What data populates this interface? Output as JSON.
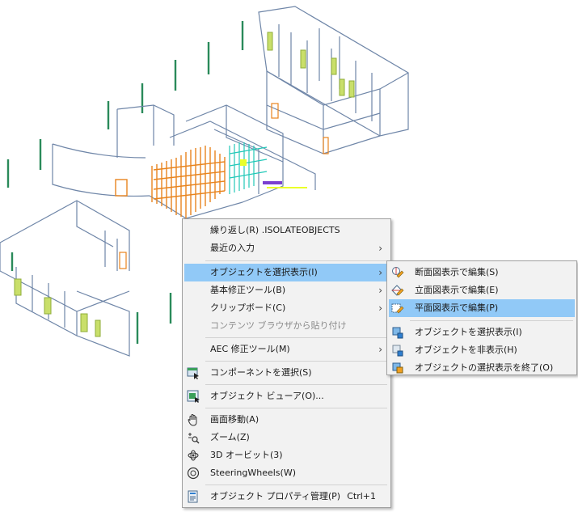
{
  "context_menu": {
    "items": [
      {
        "label": "繰り返し(R) .ISOLATEOBJECTS"
      },
      {
        "label": "最近の入力",
        "arrow": "›"
      },
      {
        "label": "オブジェクトを選択表示(I)",
        "arrow": "›"
      },
      {
        "label": "基本修正ツール(B)",
        "arrow": "›"
      },
      {
        "label": "クリップボード(C)",
        "arrow": "›"
      },
      {
        "label": "コンテンツ ブラウザから貼り付け"
      },
      {
        "label": "AEC 修正ツール(M)",
        "arrow": "›"
      },
      {
        "label": "コンポーネントを選択(S)",
        "icon": "component-select-icon"
      },
      {
        "label": "オブジェクト ビューア(O)...",
        "icon": "object-viewer-icon"
      },
      {
        "label": "画面移動(A)",
        "icon": "hand-pan-icon"
      },
      {
        "label": "ズーム(Z)",
        "icon": "zoom-icon"
      },
      {
        "label": "3D オービット(3)",
        "icon": "orbit-icon"
      },
      {
        "label": "SteeringWheels(W)",
        "icon": "steering-wheel-icon"
      },
      {
        "label": "オブジェクト プロパティ管理(P)",
        "icon": "properties-icon",
        "shortcut": "Ctrl+1"
      }
    ]
  },
  "submenu": {
    "items": [
      {
        "label": "断面図表示で編集(S)",
        "icon": "section-edit-icon"
      },
      {
        "label": "立面図表示で編集(E)",
        "icon": "elevation-edit-icon"
      },
      {
        "label": "平面図表示で編集(P)",
        "icon": "plan-edit-icon"
      },
      {
        "label": "オブジェクトを選択表示(I)",
        "icon": "isolate-objects-icon"
      },
      {
        "label": "オブジェクトを非表示(H)",
        "icon": "hide-objects-icon"
      },
      {
        "label": "オブジェクトの選択表示を終了(O)",
        "icon": "end-isolation-icon"
      }
    ]
  },
  "colors": {
    "highlight": "#91c9f7",
    "menu_bg": "#f2f2f2",
    "wall_stroke": "#6f86a8",
    "door_orange": "#e8841e",
    "window_green": "#2a8a5a",
    "window_yellow": "#b8d64a",
    "grid_cyan": "#22c8b8"
  }
}
